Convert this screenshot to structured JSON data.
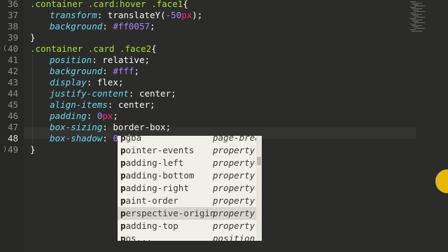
{
  "editor": {
    "line_numbers": [
      "36",
      "37",
      "38",
      "39",
      "40",
      "41",
      "42",
      "43",
      "44",
      "45",
      "46",
      "47",
      "48",
      "49"
    ],
    "active_line": "48",
    "code_lines": [
      {
        "indent": 0,
        "tokens": [
          {
            "t": ".container .card:hover .face1",
            "c": "sel"
          },
          {
            "t": "{",
            "c": "punc"
          }
        ]
      },
      {
        "indent": 1,
        "tokens": [
          {
            "t": "transform",
            "c": "prop"
          },
          {
            "t": ": ",
            "c": "punc"
          },
          {
            "t": "translateY",
            "c": "val"
          },
          {
            "t": "(",
            "c": "punc"
          },
          {
            "t": "-50",
            "c": "num"
          },
          {
            "t": "px",
            "c": "unit"
          },
          {
            "t": ");",
            "c": "punc"
          }
        ]
      },
      {
        "indent": 1,
        "tokens": [
          {
            "t": "background",
            "c": "prop"
          },
          {
            "t": ": ",
            "c": "punc"
          },
          {
            "t": "#ff0057",
            "c": "num"
          },
          {
            "t": ";",
            "c": "punc"
          }
        ]
      },
      {
        "indent": 0,
        "tokens": [
          {
            "t": "}",
            "c": "punc"
          }
        ]
      },
      {
        "indent": 0,
        "tokens": [
          {
            "t": ".container .card .face2",
            "c": "sel"
          },
          {
            "t": "{",
            "c": "punc"
          }
        ]
      },
      {
        "indent": 1,
        "tokens": [
          {
            "t": "position",
            "c": "prop"
          },
          {
            "t": ": ",
            "c": "punc"
          },
          {
            "t": "relative",
            "c": "val"
          },
          {
            "t": ";",
            "c": "punc"
          }
        ]
      },
      {
        "indent": 1,
        "tokens": [
          {
            "t": "background",
            "c": "prop"
          },
          {
            "t": ": ",
            "c": "punc"
          },
          {
            "t": "#fff",
            "c": "num"
          },
          {
            "t": ";",
            "c": "punc"
          }
        ]
      },
      {
        "indent": 1,
        "tokens": [
          {
            "t": "display",
            "c": "prop"
          },
          {
            "t": ": ",
            "c": "punc"
          },
          {
            "t": "flex",
            "c": "val"
          },
          {
            "t": ";",
            "c": "punc"
          }
        ]
      },
      {
        "indent": 1,
        "tokens": [
          {
            "t": "justify-content",
            "c": "prop"
          },
          {
            "t": ": ",
            "c": "punc"
          },
          {
            "t": "center",
            "c": "val"
          },
          {
            "t": ";",
            "c": "punc"
          }
        ]
      },
      {
        "indent": 1,
        "tokens": [
          {
            "t": "align-items",
            "c": "prop"
          },
          {
            "t": ": ",
            "c": "punc"
          },
          {
            "t": "center",
            "c": "val"
          },
          {
            "t": ";",
            "c": "punc"
          }
        ]
      },
      {
        "indent": 1,
        "tokens": [
          {
            "t": "padding",
            "c": "prop"
          },
          {
            "t": ": ",
            "c": "punc"
          },
          {
            "t": "0",
            "c": "num"
          },
          {
            "t": "px",
            "c": "unit"
          },
          {
            "t": ";",
            "c": "punc"
          }
        ]
      },
      {
        "indent": 1,
        "tokens": [
          {
            "t": "box-sizing",
            "c": "prop"
          },
          {
            "t": ": ",
            "c": "punc"
          },
          {
            "t": "border-box",
            "c": "val"
          },
          {
            "t": ";",
            "c": "punc"
          }
        ]
      },
      {
        "indent": 1,
        "tokens": [
          {
            "t": "box-shadow",
            "c": "prop"
          },
          {
            "t": ": ",
            "c": "punc"
          },
          {
            "t": "0",
            "c": "num"
          },
          {
            "t": " p",
            "c": "val"
          }
        ]
      },
      {
        "indent": 0,
        "tokens": [
          {
            "t": "}",
            "c": "punc"
          }
        ]
      }
    ]
  },
  "autocomplete": {
    "match_prefix": "p",
    "selected_index": 7,
    "items": [
      {
        "name": "pgba",
        "type": "page-break-after"
      },
      {
        "name": "pointer-events",
        "type": "property"
      },
      {
        "name": "padding-left",
        "type": "property"
      },
      {
        "name": "padding-bottom",
        "type": "property"
      },
      {
        "name": "padding-right",
        "type": "property"
      },
      {
        "name": "paint-order",
        "type": "property"
      },
      {
        "name": "perspective-origin",
        "type": "property"
      },
      {
        "name": "padding-top",
        "type": "property"
      },
      {
        "name": "pos...",
        "type": "position: static"
      }
    ]
  },
  "colors": {
    "background": "#2b2b29",
    "selector": "#a6e22e",
    "property": "#66d9ef",
    "number": "#ae81ff",
    "unit": "#f92672",
    "popup_background": "#f0f0e8",
    "cursor_highlight": "#e6b800"
  }
}
